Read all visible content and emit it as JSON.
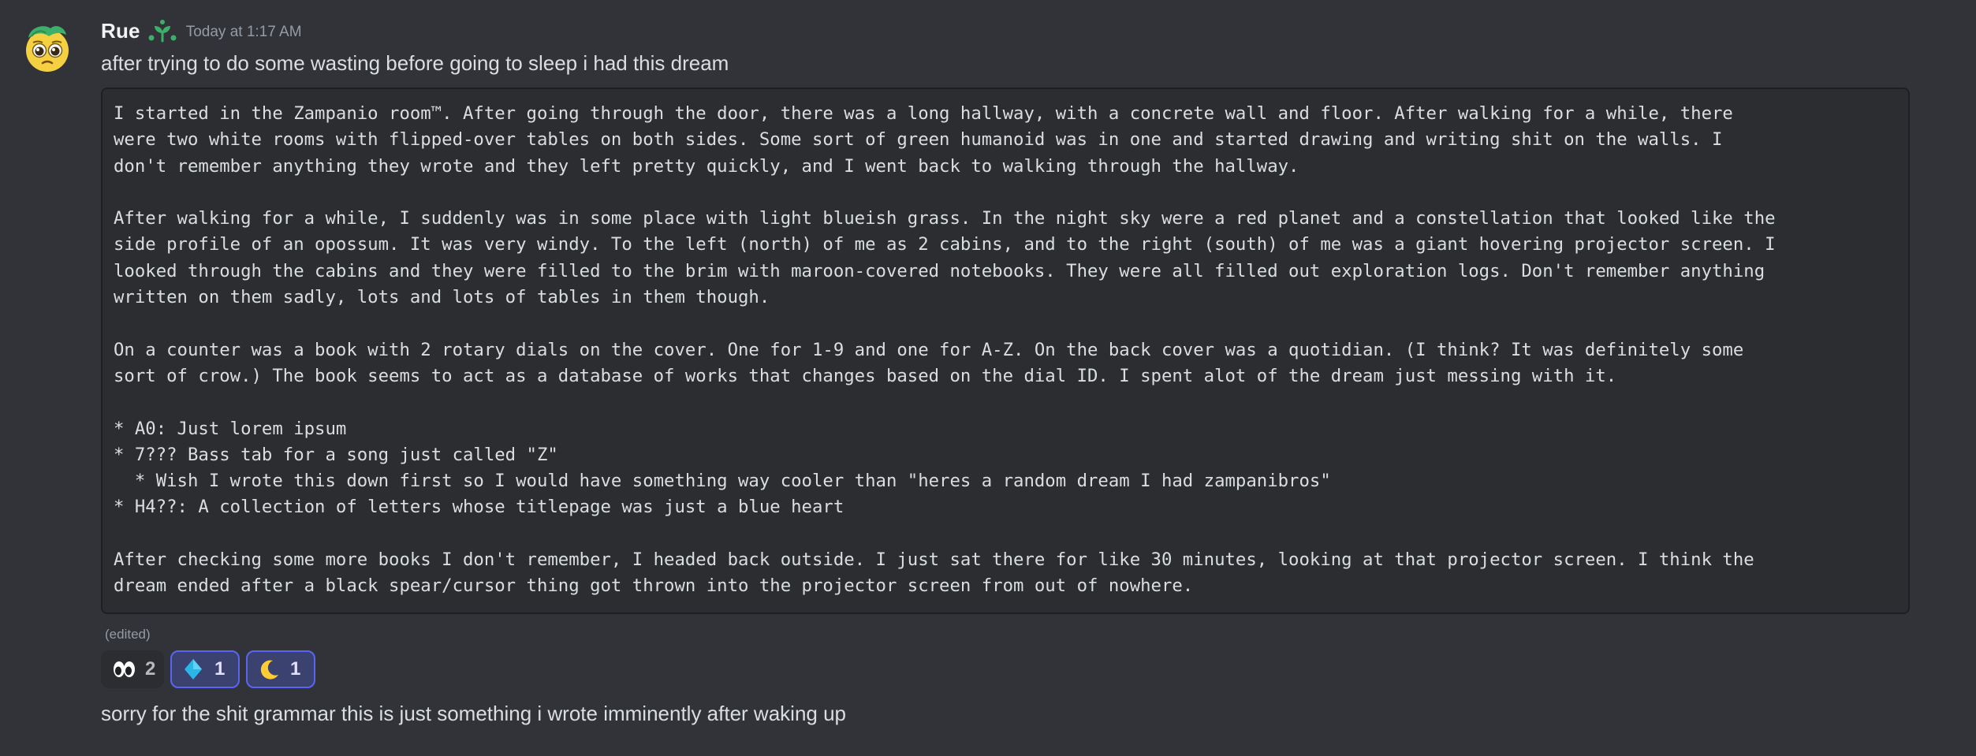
{
  "message": {
    "author": "Rue",
    "timestamp": "Today at 1:17 AM",
    "intro_text": "after trying to do some wasting before going to sleep i had this dream",
    "code_block": "I started in the Zampanio room™. After going through the door, there was a long hallway, with a concrete wall and floor. After walking for a while, there\nwere two white rooms with flipped-over tables on both sides. Some sort of green humanoid was in one and started drawing and writing shit on the walls. I\ndon't remember anything they wrote and they left pretty quickly, and I went back to walking through the hallway.\n\nAfter walking for a while, I suddenly was in some place with light blueish grass. In the night sky were a red planet and a constellation that looked like the\nside profile of an opossum. It was very windy. To the left (north) of me as 2 cabins, and to the right (south) of me was a giant hovering projector screen. I\nlooked through the cabins and they were filled to the brim with maroon-covered notebooks. They were all filled out exploration logs. Don't remember anything\nwritten on them sadly, lots and lots of tables in them though.\n\nOn a counter was a book with 2 rotary dials on the cover. One for 1-9 and one for A-Z. On the back cover was a quotidian. (I think? It was definitely some\nsort of crow.) The book seems to act as a database of works that changes based on the dial ID. I spent alot of the dream just messing with it.\n\n* A0: Just lorem ipsum\n* 7??? Bass tab for a song just called \"Z\"\n  * Wish I wrote this down first so I would have something way cooler than \"heres a random dream I had zampanibros\"\n* H4??: A collection of letters whose titlepage was just a blue heart\n\nAfter checking some more books I don't remember, I headed back outside. I just sat there for like 30 minutes, looking at that projector screen. I think the\ndream ended after a black spear/cursor thing got thrown into the projector screen from out of nowhere.",
    "edited_label": "(edited)",
    "reactions": [
      {
        "emoji": "eyes-icon",
        "count": "2",
        "active": false
      },
      {
        "emoji": "blue-diamond-icon",
        "count": "1",
        "active": true
      },
      {
        "emoji": "crescent-moon-icon",
        "count": "1",
        "active": true
      }
    ],
    "followup_text": "sorry for the shit grammar this is just something i wrote imminently after waking up"
  },
  "colors": {
    "background": "#313338",
    "code_background": "#2b2d31",
    "active_reaction_border": "#5865f2",
    "active_reaction_bg": "#3c4270",
    "username": "#f2f3f5",
    "muted": "#949ba4"
  }
}
